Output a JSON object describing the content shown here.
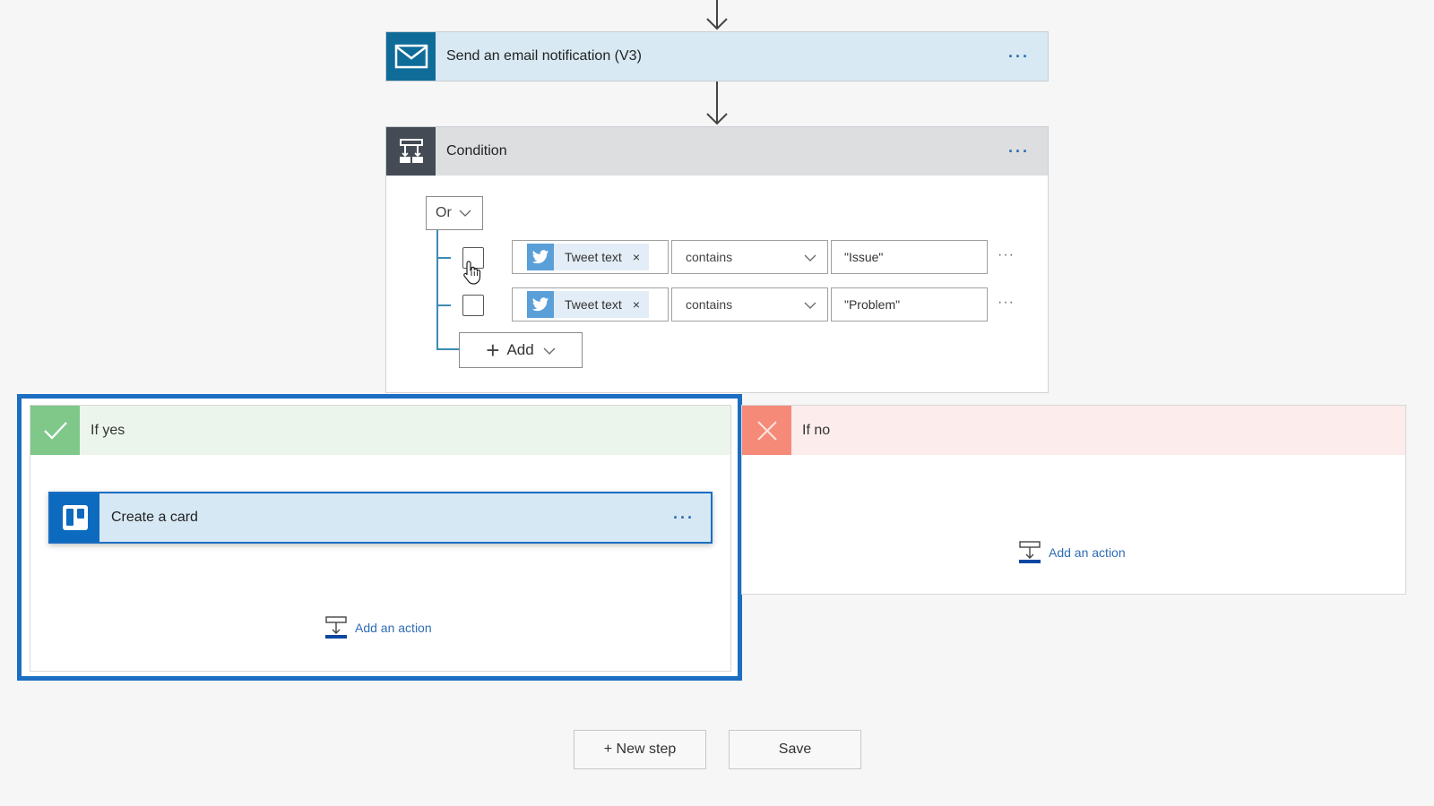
{
  "flow": {
    "email_action": {
      "title": "Send an email notification (V3)",
      "icon": "mail-icon",
      "menu": "···"
    },
    "condition": {
      "title": "Condition",
      "icon": "condition-icon",
      "menu": "···",
      "group_operator": "Or",
      "rows": [
        {
          "checked": false,
          "token_label": "Tweet text",
          "token_icon": "twitter-icon",
          "token_remove": "×",
          "operator": "contains",
          "value": "\"Issue\"",
          "menu": "···"
        },
        {
          "checked": false,
          "token_label": "Tweet text",
          "token_icon": "twitter-icon",
          "token_remove": "×",
          "operator": "contains",
          "value": "\"Problem\"",
          "menu": "···"
        }
      ],
      "add_label": "Add"
    },
    "if_yes": {
      "title": "If yes",
      "color": "#7fc88a",
      "actions": [
        {
          "title": "Create a card",
          "icon": "trello-icon",
          "menu": "···"
        }
      ],
      "add_action_label": "Add an action"
    },
    "if_no": {
      "title": "If no",
      "color": "#f58a78",
      "add_action_label": "Add an action"
    }
  },
  "footer": {
    "new_step_label": "+ New step",
    "save_label": "Save"
  },
  "colors": {
    "accent": "#1b6ec2",
    "email_icon_bg": "#0f6c99",
    "condition_icon_bg": "#444b55",
    "trello_icon_bg": "#0c6abf",
    "twitter_blue": "#5a9fd8",
    "link_blue": "#2f6db5"
  }
}
